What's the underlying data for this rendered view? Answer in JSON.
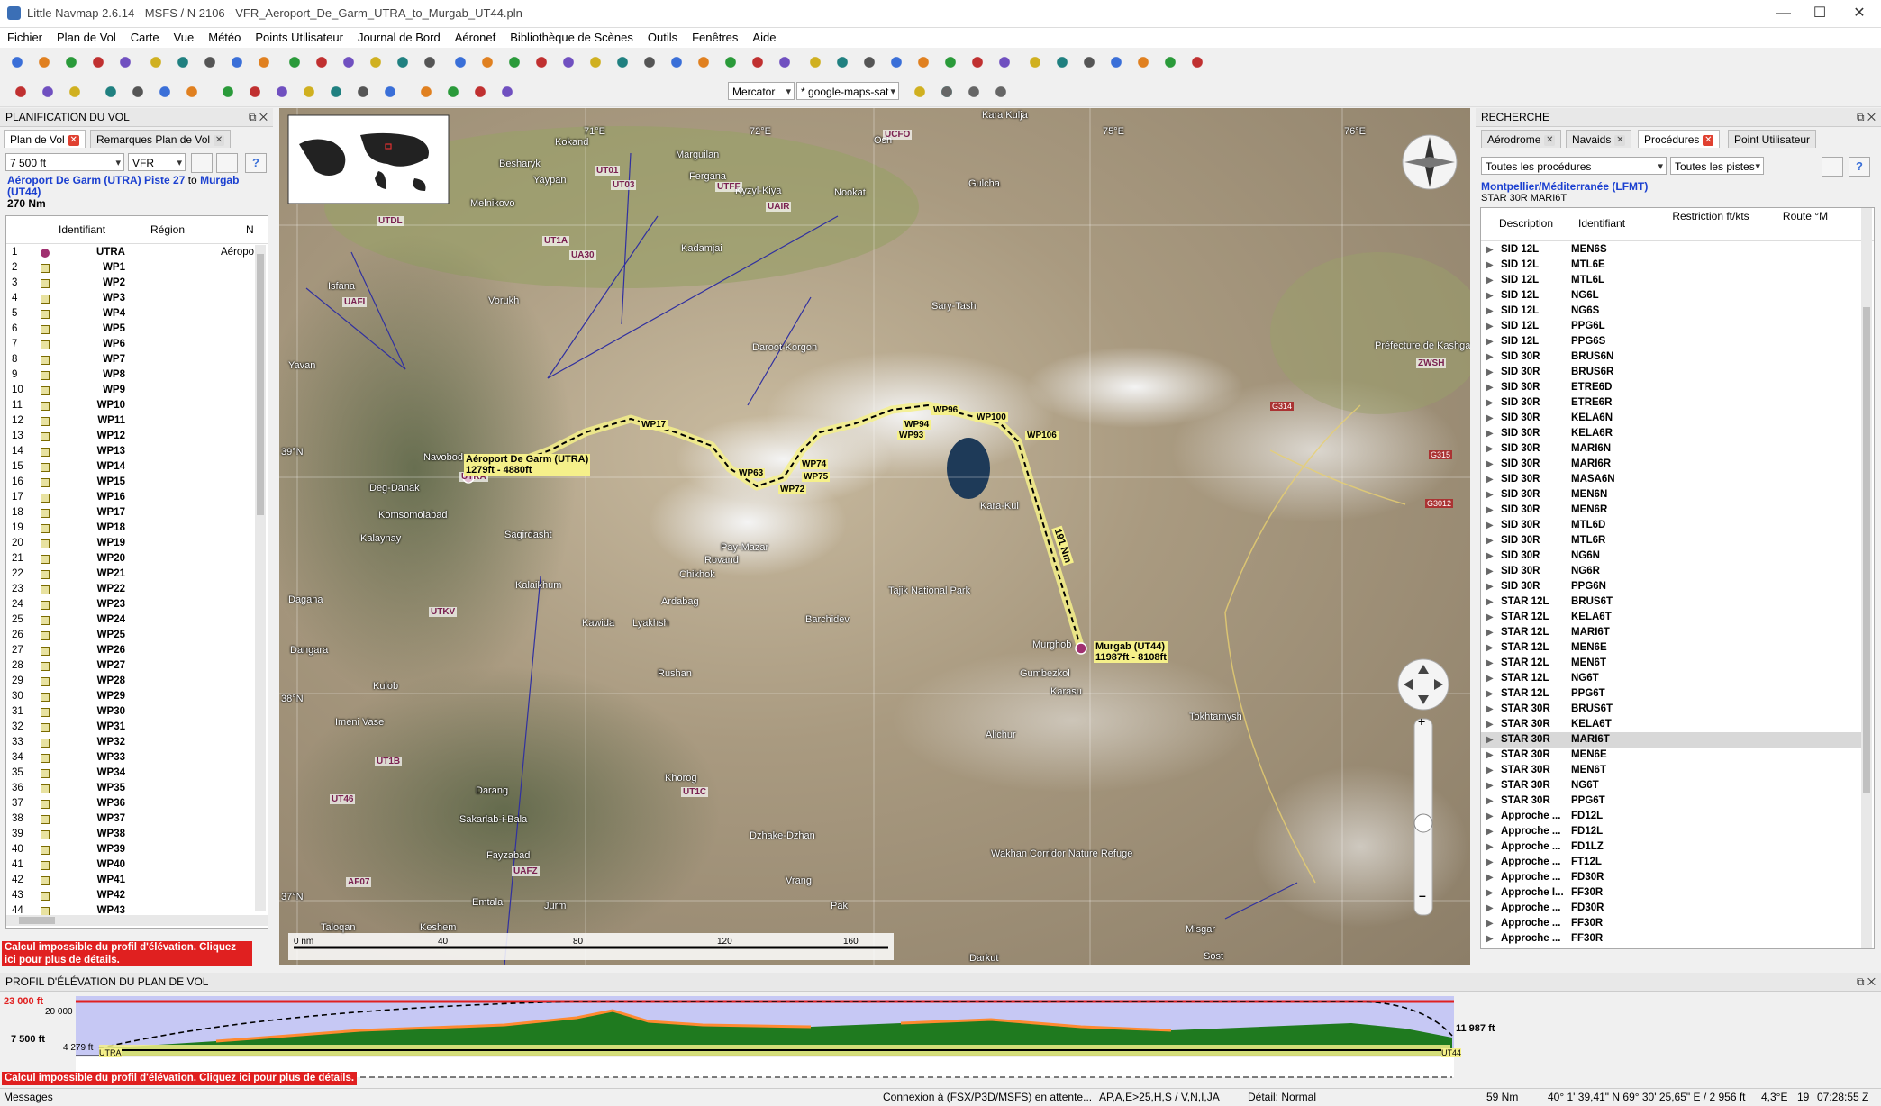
{
  "window": {
    "title": "Little Navmap 2.6.14 - MSFS / N 2106 - VFR_Aeroport_De_Garm_UTRA_to_Murgab_UT44.pln",
    "minimize": "—",
    "maximize": "☐",
    "close": "✕"
  },
  "menu": [
    "Fichier",
    "Plan de Vol",
    "Carte",
    "Vue",
    "Météo",
    "Points Utilisateur",
    "Journal de Bord",
    "Aéronef",
    "Bibliothèque de Scènes",
    "Outils",
    "Fenêtres",
    "Aide"
  ],
  "toolbar2": {
    "projection": "Mercator",
    "theme": "* google-maps-sat"
  },
  "left": {
    "header": "PLANIFICATION DU VOL",
    "tabs": [
      "Plan de Vol",
      "Remarques Plan de Vol"
    ],
    "altitude": "7 500 ft",
    "rules": "VFR",
    "route_from": "Aéroport De Garm (UTRA) Piste 27",
    "route_to_word": "to",
    "route_to": "Murgab (UT44)",
    "distance": "270 Nm",
    "columns": [
      "Identifiant",
      "Région",
      "N"
    ],
    "rows": [
      {
        "n": "1",
        "id": "UTRA",
        "extra": "Aéropo"
      },
      {
        "n": "2",
        "id": "WP1"
      },
      {
        "n": "3",
        "id": "WP2"
      },
      {
        "n": "4",
        "id": "WP3"
      },
      {
        "n": "5",
        "id": "WP4"
      },
      {
        "n": "6",
        "id": "WP5"
      },
      {
        "n": "7",
        "id": "WP6"
      },
      {
        "n": "8",
        "id": "WP7"
      },
      {
        "n": "9",
        "id": "WP8"
      },
      {
        "n": "10",
        "id": "WP9"
      },
      {
        "n": "11",
        "id": "WP10"
      },
      {
        "n": "12",
        "id": "WP11"
      },
      {
        "n": "13",
        "id": "WP12"
      },
      {
        "n": "14",
        "id": "WP13"
      },
      {
        "n": "15",
        "id": "WP14"
      },
      {
        "n": "16",
        "id": "WP15"
      },
      {
        "n": "17",
        "id": "WP16"
      },
      {
        "n": "18",
        "id": "WP17"
      },
      {
        "n": "19",
        "id": "WP18"
      },
      {
        "n": "20",
        "id": "WP19"
      },
      {
        "n": "21",
        "id": "WP20"
      },
      {
        "n": "22",
        "id": "WP21"
      },
      {
        "n": "23",
        "id": "WP22"
      },
      {
        "n": "24",
        "id": "WP23"
      },
      {
        "n": "25",
        "id": "WP24"
      },
      {
        "n": "26",
        "id": "WP25"
      },
      {
        "n": "27",
        "id": "WP26"
      },
      {
        "n": "28",
        "id": "WP27"
      },
      {
        "n": "29",
        "id": "WP28"
      },
      {
        "n": "30",
        "id": "WP29"
      },
      {
        "n": "31",
        "id": "WP30"
      },
      {
        "n": "32",
        "id": "WP31"
      },
      {
        "n": "33",
        "id": "WP32"
      },
      {
        "n": "34",
        "id": "WP33"
      },
      {
        "n": "35",
        "id": "WP34"
      },
      {
        "n": "36",
        "id": "WP35"
      },
      {
        "n": "37",
        "id": "WP36"
      },
      {
        "n": "38",
        "id": "WP37"
      },
      {
        "n": "39",
        "id": "WP38"
      },
      {
        "n": "40",
        "id": "WP39"
      },
      {
        "n": "41",
        "id": "WP40"
      },
      {
        "n": "42",
        "id": "WP41"
      },
      {
        "n": "43",
        "id": "WP42"
      },
      {
        "n": "44",
        "id": "WP43"
      }
    ],
    "error": "Calcul impossible du profil d'élévation. Cliquez ici pour plus de détails."
  },
  "map": {
    "labels": [
      "Kokand",
      "Marguilan",
      "Fergana",
      "Kyzyl-Kiya",
      "Nookat",
      "Osh",
      "Kara Kulja",
      "Gulcha",
      "Sary-Tash",
      "Daroot-Korgon",
      "Kadamjai",
      "Navobod",
      "Deg-Danak",
      "Komsomolabad",
      "Kalaynay",
      "Sagirdasht",
      "Pay-Mazar",
      "Rovand",
      "Chikhok",
      "Ardabag",
      "Kalaikhum",
      "Kawida",
      "Lyakhsh",
      "Barchidev",
      "Tajik National Park",
      "Murghob",
      "Karasu",
      "Gumbezkol",
      "Alichur",
      "Tokhtamysh",
      "Rushan",
      "Khorog",
      "Darang",
      "Sakarlab-i-Bala",
      "Fayzabad",
      "Dzhake-Dzhan",
      "Vrang",
      "Wakhan Corridor Nature Refuge",
      "Imeni Vase",
      "Kulob",
      "Dangara",
      "Dagana",
      "Yavan",
      "Besharyk",
      "Yaypan",
      "Melnikovo",
      "Isfana",
      "Vorukh",
      "Kara-Kul",
      "Préfecture de Kashgar",
      "Keshem",
      "Taloqan",
      "Misgar",
      "Sost",
      "Darkut",
      "Emtala",
      "Jurm",
      "Pak"
    ],
    "waypoints": [
      "WP6",
      "WP17",
      "WP63",
      "WP72",
      "WP74",
      "WP75",
      "WP93",
      "WP94",
      "WP96",
      "WP100",
      "WP106"
    ],
    "airports": [
      "UTRA",
      "UT01",
      "UT03",
      "UT1A",
      "UA30",
      "UAFI",
      "UTFF",
      "UAIR",
      "UCFO",
      "UTDL",
      "UTKV",
      "UT1B",
      "UT46",
      "UT1C",
      "UAFZ",
      "AF07",
      "ZWSH"
    ],
    "roads": [
      "G314",
      "G315",
      "G3012"
    ],
    "lat_labels": [
      "39°N",
      "38°N",
      "37°N"
    ],
    "lon_labels": [
      "71°E",
      "72°E",
      "75°E",
      "76°E"
    ],
    "origin_label": "Aéroport De Garm (UTRA)",
    "origin_elev": "1279ft - 4880ft",
    "dest_label": "Murgab (UT44)",
    "dest_elev": "11987ft - 8108ft",
    "leg_label": "191 Nm",
    "scale": [
      "0 nm",
      "40",
      "80",
      "120",
      "160"
    ]
  },
  "right": {
    "header": "RECHERCHE",
    "tabs": [
      "Aérodrome",
      "Navaids",
      "Procédures",
      "Point Utilisateur"
    ],
    "filter1": "Toutes les procédures",
    "filter2": "Toutes les pistes",
    "airport": "Montpellier/Méditerranée (LFMT)",
    "selected": "STAR 30R MARI6T",
    "columns": [
      "Description",
      "Identifiant",
      "Restriction ft/kts",
      "Route °M"
    ],
    "rows": [
      {
        "d": "SID 12L",
        "i": "MEN6S"
      },
      {
        "d": "SID 12L",
        "i": "MTL6E"
      },
      {
        "d": "SID 12L",
        "i": "MTL6L"
      },
      {
        "d": "SID 12L",
        "i": "NG6L"
      },
      {
        "d": "SID 12L",
        "i": "NG6S"
      },
      {
        "d": "SID 12L",
        "i": "PPG6L"
      },
      {
        "d": "SID 12L",
        "i": "PPG6S"
      },
      {
        "d": "SID 30R",
        "i": "BRUS6N"
      },
      {
        "d": "SID 30R",
        "i": "BRUS6R"
      },
      {
        "d": "SID 30R",
        "i": "ETRE6D"
      },
      {
        "d": "SID 30R",
        "i": "ETRE6R"
      },
      {
        "d": "SID 30R",
        "i": "KELA6N"
      },
      {
        "d": "SID 30R",
        "i": "KELA6R"
      },
      {
        "d": "SID 30R",
        "i": "MARI6N"
      },
      {
        "d": "SID 30R",
        "i": "MARI6R"
      },
      {
        "d": "SID 30R",
        "i": "MASA6N"
      },
      {
        "d": "SID 30R",
        "i": "MEN6N"
      },
      {
        "d": "SID 30R",
        "i": "MEN6R"
      },
      {
        "d": "SID 30R",
        "i": "MTL6D"
      },
      {
        "d": "SID 30R",
        "i": "MTL6R"
      },
      {
        "d": "SID 30R",
        "i": "NG6N"
      },
      {
        "d": "SID 30R",
        "i": "NG6R"
      },
      {
        "d": "SID 30R",
        "i": "PPG6N"
      },
      {
        "d": "STAR 12L",
        "i": "BRUS6T"
      },
      {
        "d": "STAR 12L",
        "i": "KELA6T"
      },
      {
        "d": "STAR 12L",
        "i": "MARI6T"
      },
      {
        "d": "STAR 12L",
        "i": "MEN6E"
      },
      {
        "d": "STAR 12L",
        "i": "MEN6T"
      },
      {
        "d": "STAR 12L",
        "i": "NG6T"
      },
      {
        "d": "STAR 12L",
        "i": "PPG6T"
      },
      {
        "d": "STAR 30R",
        "i": "BRUS6T"
      },
      {
        "d": "STAR 30R",
        "i": "KELA6T"
      },
      {
        "d": "STAR 30R",
        "i": "MARI6T"
      },
      {
        "d": "STAR 30R",
        "i": "MEN6E"
      },
      {
        "d": "STAR 30R",
        "i": "MEN6T"
      },
      {
        "d": "STAR 30R",
        "i": "NG6T"
      },
      {
        "d": "STAR 30R",
        "i": "PPG6T"
      },
      {
        "d": "Approche ...",
        "i": "FD12L"
      },
      {
        "d": "Approche ...",
        "i": "FD12L"
      },
      {
        "d": "Approche ...",
        "i": "FD1LZ"
      },
      {
        "d": "Approche ...",
        "i": "FT12L"
      },
      {
        "d": "Approche ...",
        "i": "FD30R"
      },
      {
        "d": "Approche I...",
        "i": "FF30R"
      },
      {
        "d": "Approche ...",
        "i": "FD30R"
      },
      {
        "d": "Approche ...",
        "i": "FF30R"
      },
      {
        "d": "Approche ...",
        "i": "FF30R"
      }
    ],
    "selected_row": 32
  },
  "profile": {
    "header": "PROFIL D'ÉLÉVATION DU PLAN DE VOL",
    "max_alt": "23 000 ft",
    "alt2": "20 000",
    "cruise_alt": "7 500 ft",
    "start_elev": "4 279 ft",
    "end_elev": "11 987 ft",
    "end_code": "UT44",
    "start_code": "UTRA"
  },
  "status": {
    "messages": "Messages",
    "error": "Calcul impossible du profil d'élévation. Cliquez ici pour plus de détails.",
    "connection": "Connexion à (FSX/P3D/MSFS) en attente...",
    "mode": "AP,A,E>25,H,S / V,N,I,JA",
    "detail": "Détail: Normal",
    "distance": "59 Nm",
    "coords": "40° 1' 39,41\" N 69° 30' 25,65\" E / 2 956 ft",
    "mag": "4,3°E",
    "zoom": "19",
    "time": "07:28:55 Z"
  }
}
